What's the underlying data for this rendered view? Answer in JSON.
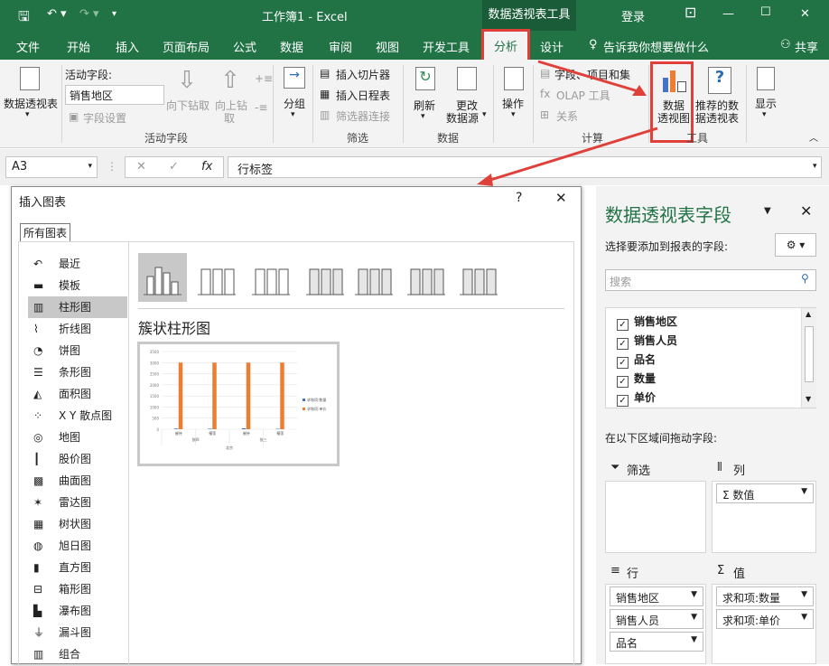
{
  "titlebar": {
    "doc_title": "工作簿1  -  Excel",
    "context_tab": "数据透视表工具",
    "login": "登录"
  },
  "tabs": [
    "文件",
    "开始",
    "插入",
    "页面布局",
    "公式",
    "数据",
    "审阅",
    "视图",
    "开发工具",
    "分析",
    "设计"
  ],
  "tell_me": "告诉我你想要做什么",
  "share": "共享",
  "ribbon": {
    "pivot_table": "数据透视表",
    "active_field_label": "活动字段:",
    "active_field_value": "销售地区",
    "field_settings": "字段设置",
    "drill_down": "向下钻取",
    "drill_up_1": "向上钻",
    "drill_up_2": "取",
    "group": "分组",
    "insert_slicer": "插入切片器",
    "insert_timeline": "插入日程表",
    "filter_connections": "筛选器连接",
    "refresh": "刷新",
    "change_source_1": "更改",
    "change_source_2": "数据源",
    "actions": "操作",
    "fields_items_sets": "字段、项目和集",
    "olap_tools": "OLAP 工具",
    "relationships": "关系",
    "pivot_chart_1": "数据",
    "pivot_chart_2": "透视图",
    "recommended_1": "推荐的数",
    "recommended_2": "据透视表",
    "show": "显示",
    "groups": {
      "active_field": "活动字段",
      "filter": "筛选",
      "data": "数据",
      "calc": "计算",
      "tools": "工具"
    }
  },
  "formula_bar": {
    "name_box": "A3",
    "formula": "行标签"
  },
  "dialog": {
    "title": "插入图表",
    "help": "?",
    "all_charts_tab": "所有图表",
    "categories": [
      "最近",
      "模板",
      "柱形图",
      "折线图",
      "饼图",
      "条形图",
      "面积图",
      "X Y 散点图",
      "地图",
      "股价图",
      "曲面图",
      "雷达图",
      "树状图",
      "旭日图",
      "直方图",
      "箱形图",
      "瀑布图",
      "漏斗图",
      "组合"
    ],
    "selected_category": "柱形图",
    "subtype_title": "簇状柱形图"
  },
  "chart_data": {
    "type": "bar",
    "categories": [
      "催持",
      "榴莲",
      "催持",
      "榴莲"
    ],
    "groups": [
      "张四",
      "张三"
    ],
    "group_label": "北京",
    "series": [
      {
        "name": "求和项:数量",
        "values": [
          30,
          25,
          40,
          20
        ],
        "color": "#4472c4"
      },
      {
        "name": "求和项:单价",
        "values": [
          3000,
          3000,
          3000,
          3000
        ],
        "color": "#ed7d31"
      }
    ],
    "yticks": [
      "3500",
      "3000",
      "2500",
      "2000",
      "1500",
      "1000",
      "500",
      "0"
    ],
    "ylim": [
      0,
      3500
    ]
  },
  "pane": {
    "title": "数据透视表字段",
    "choose_label": "选择要添加到报表的字段:",
    "search_placeholder": "搜索",
    "fields": [
      "销售地区",
      "销售人员",
      "品名",
      "数量",
      "单价"
    ],
    "drag_label": "在以下区域间拖动字段:",
    "filter_label": "筛选",
    "columns_label": "列",
    "rows_label": "行",
    "values_label": "值",
    "columns_items": [
      "Σ 数值"
    ],
    "rows_items": [
      "销售地区",
      "销售人员",
      "品名"
    ],
    "values_items": [
      "求和项:数量",
      "求和项:单价"
    ]
  },
  "colors": {
    "excel_green": "#217346",
    "highlight_red": "#e0403a"
  }
}
